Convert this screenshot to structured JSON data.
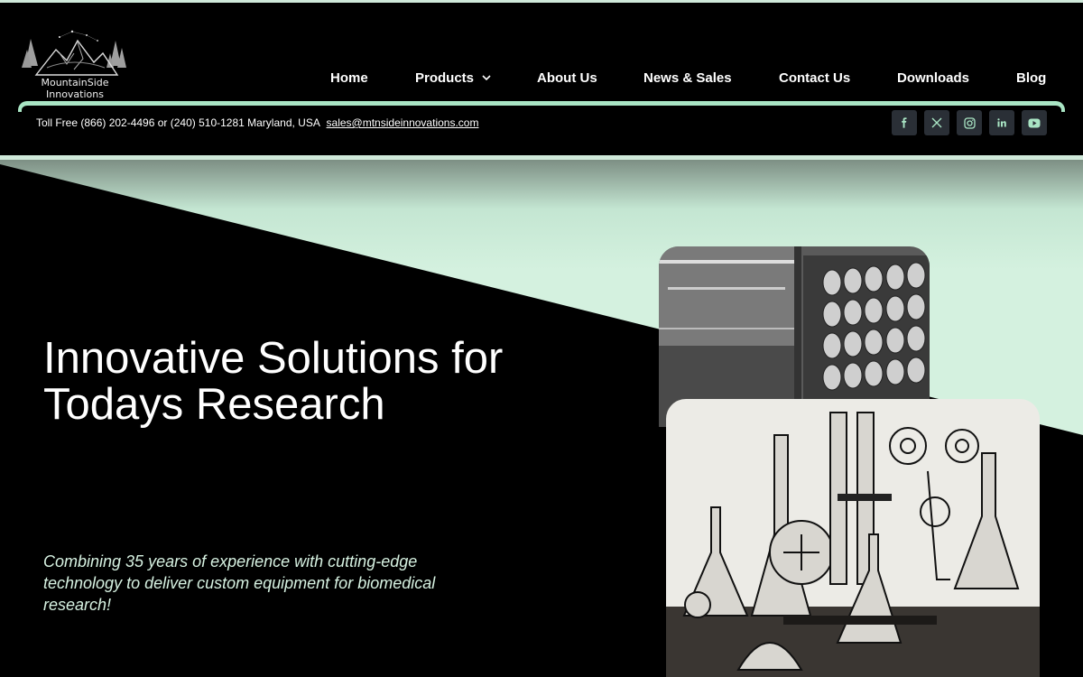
{
  "logo": {
    "line1": "MountainSide",
    "line2": "Innovations",
    "icon": "mountain-logo-icon"
  },
  "nav": {
    "items": [
      {
        "label": "Home"
      },
      {
        "label": "Products",
        "has_dropdown": true
      },
      {
        "label": "About Us"
      },
      {
        "label": "News & Sales"
      },
      {
        "label": "Contact Us"
      },
      {
        "label": "Downloads"
      },
      {
        "label": "Blog"
      }
    ]
  },
  "contact": {
    "text": "Toll Free (866) 202-4496 or (240) 510-1281  Maryland, USA",
    "email": "sales@mtnsideinnovations.com"
  },
  "social": [
    "facebook-icon",
    "x-icon",
    "instagram-icon",
    "linkedin-icon",
    "youtube-icon"
  ],
  "hero": {
    "title_line1": "Innovative Solutions for",
    "title_line2": "Todays Research",
    "subtitle": "Combining 35 years of experience with cutting-edge technology to deliver custom equipment for biomedical research!"
  },
  "colors": {
    "accent": "#a9e5c4",
    "light_mint": "#d4f1df",
    "background": "#000000",
    "social_bg": "#2a2f36"
  }
}
